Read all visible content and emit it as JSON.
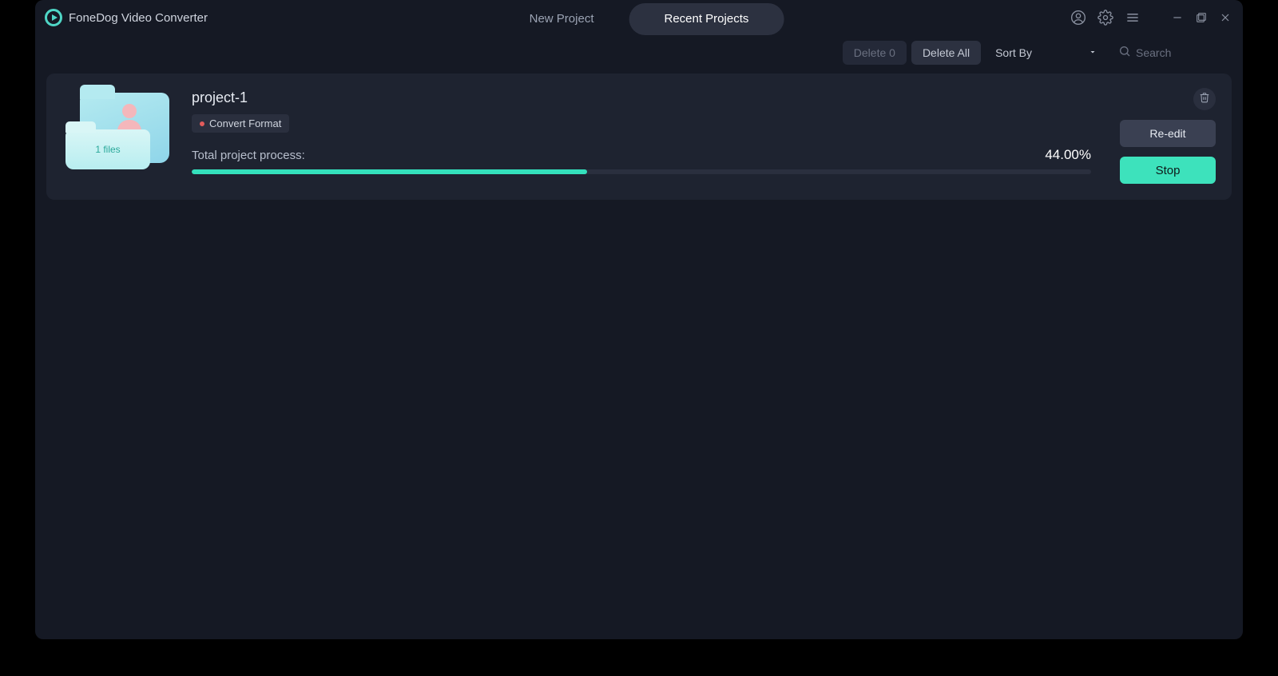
{
  "app": {
    "title": "FoneDog Video Converter"
  },
  "tabs": {
    "new_project": "New Project",
    "recent_projects": "Recent Projects"
  },
  "toolbar": {
    "delete_label": "Delete 0",
    "delete_all_label": "Delete All",
    "sort_label": "Sort By",
    "search_placeholder": "Search"
  },
  "project": {
    "name": "project-1",
    "badge": "Convert Format",
    "files_text": "1 files",
    "process_label": "Total project process:",
    "process_pct_text": "44.00%",
    "process_pct_value": 44.0,
    "reedit_label": "Re-edit",
    "stop_label": "Stop"
  }
}
